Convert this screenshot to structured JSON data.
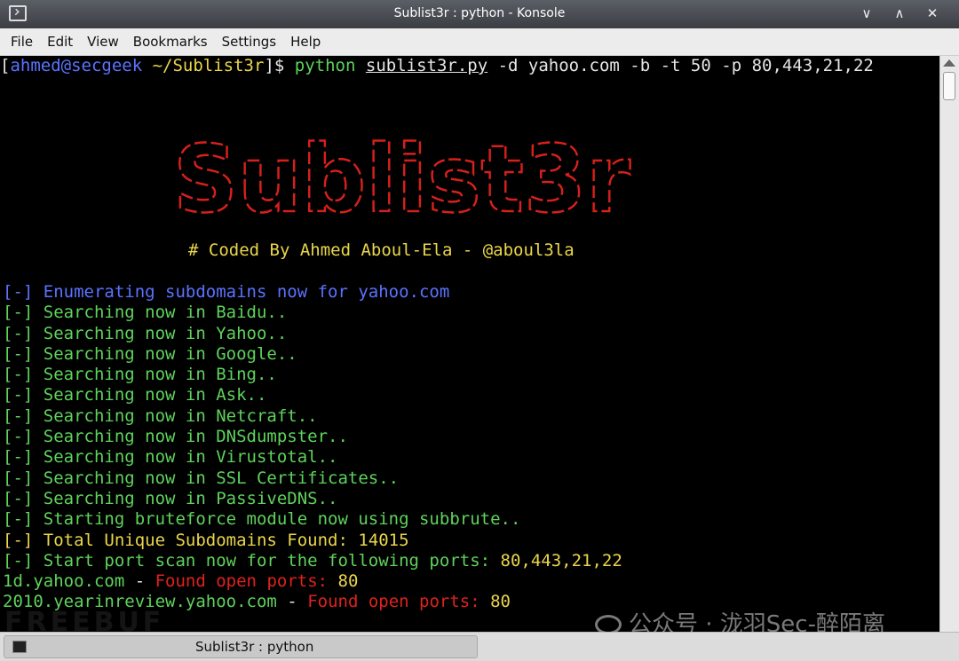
{
  "window": {
    "title": "Sublist3r : python - Konsole",
    "buttons": [
      "∨",
      "∧",
      "✕"
    ]
  },
  "menu": [
    "File",
    "Edit",
    "View",
    "Bookmarks",
    "Settings",
    "Help"
  ],
  "prompt": {
    "open_bracket": "[",
    "user_host": "ahmed@secgeek",
    "path": " ~/Sublist3r",
    "close": "]$ ",
    "cmd": "python",
    "space": " ",
    "script": "sublist3r.py",
    "args": " -d yahoo.com -b -t 50 -p 80,443,21,22"
  },
  "banner": {
    "logo_text": "Sublist3r",
    "coded_by": "# Coded By Ahmed Aboul-Ela - @aboul3la"
  },
  "output": {
    "enumerating": "[-] Enumerating subdomains now for yahoo.com",
    "searching": [
      "[-] Searching now in Baidu..",
      "[-] Searching now in Yahoo..",
      "[-] Searching now in Google..",
      "[-] Searching now in Bing..",
      "[-] Searching now in Ask..",
      "[-] Searching now in Netcraft..",
      "[-] Searching now in DNSdumpster..",
      "[-] Searching now in Virustotal..",
      "[-] Searching now in SSL Certificates..",
      "[-] Searching now in PassiveDNS..",
      "[-] Starting bruteforce module now using subbrute.."
    ],
    "total": "[-] Total Unique Subdomains Found: 14015",
    "port_scan_prefix": "[-] Start port scan now for the following ports: ",
    "port_scan_ports": "80,443,21,22",
    "results": [
      {
        "host": "1d.yahoo.com",
        "sep": " - ",
        "found": "Found open ports:",
        "ports": " 80"
      },
      {
        "host": "2010.yearinreview.yahoo.com",
        "sep": " - ",
        "found": "Found open ports:",
        "ports": " 80"
      }
    ]
  },
  "taskbar": {
    "task_label": "Sublist3r : python"
  },
  "watermark": {
    "text": "公众号 · 泷羽Sec-醉陌离",
    "faint": "FREEBUF"
  },
  "colors": {
    "green": "#5ed35b",
    "blue": "#5a73ff",
    "yellow": "#ead64a",
    "red": "#e0221c"
  }
}
